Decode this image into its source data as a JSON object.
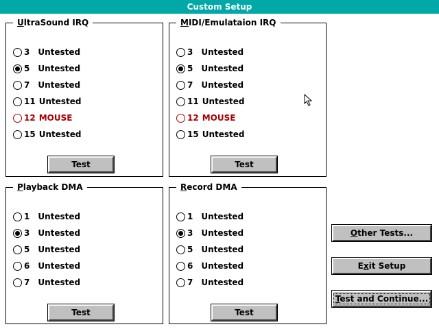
{
  "window": {
    "title": "Custom Setup"
  },
  "ultrasound_irq": {
    "label_u": "U",
    "label_rest": "ltraSound IRQ",
    "options": [
      {
        "num": "3",
        "status": "Untested",
        "selected": false,
        "conflict": false
      },
      {
        "num": "5",
        "status": "Untested",
        "selected": true,
        "conflict": false
      },
      {
        "num": "7",
        "status": "Untested",
        "selected": false,
        "conflict": false
      },
      {
        "num": "11",
        "status": "Untested",
        "selected": false,
        "conflict": false
      },
      {
        "num": "12",
        "status": "MOUSE",
        "selected": false,
        "conflict": true
      },
      {
        "num": "15",
        "status": "Untested",
        "selected": false,
        "conflict": false
      }
    ],
    "test_label": "Test"
  },
  "midi_irq": {
    "label_u": "M",
    "label_rest": "IDI/Emulataion IRQ",
    "options": [
      {
        "num": "3",
        "status": "Untested",
        "selected": false,
        "conflict": false
      },
      {
        "num": "5",
        "status": "Untested",
        "selected": true,
        "conflict": false
      },
      {
        "num": "7",
        "status": "Untested",
        "selected": false,
        "conflict": false
      },
      {
        "num": "11",
        "status": "Untested",
        "selected": false,
        "conflict": false
      },
      {
        "num": "12",
        "status": "MOUSE",
        "selected": false,
        "conflict": true
      },
      {
        "num": "15",
        "status": "Untested",
        "selected": false,
        "conflict": false
      }
    ],
    "test_label": "Test"
  },
  "playback_dma": {
    "label_u": "P",
    "label_rest": "layback DMA",
    "options": [
      {
        "num": "1",
        "status": "Untested",
        "selected": false
      },
      {
        "num": "3",
        "status": "Untested",
        "selected": true
      },
      {
        "num": "5",
        "status": "Untested",
        "selected": false
      },
      {
        "num": "6",
        "status": "Untested",
        "selected": false
      },
      {
        "num": "7",
        "status": "Untested",
        "selected": false
      }
    ],
    "test_label": "Test"
  },
  "record_dma": {
    "label_u": "R",
    "label_rest": "ecord DMA",
    "options": [
      {
        "num": "1",
        "status": "Untested",
        "selected": false
      },
      {
        "num": "3",
        "status": "Untested",
        "selected": true
      },
      {
        "num": "5",
        "status": "Untested",
        "selected": false
      },
      {
        "num": "6",
        "status": "Untested",
        "selected": false
      },
      {
        "num": "7",
        "status": "Untested",
        "selected": false
      }
    ],
    "test_label": "Test"
  },
  "buttons": {
    "other_tests_u": "O",
    "other_tests_rest": "ther Tests...",
    "exit_setup_pre": "E",
    "exit_setup_u": "x",
    "exit_setup_rest": "it Setup",
    "test_continue_u": "T",
    "test_continue_rest": "est and Continue..."
  },
  "colors": {
    "title_bg": "#00a8a8",
    "conflict": "#a80000",
    "button_face": "#c0c0c0"
  },
  "icons": {
    "cursor": "arrow-pointer-icon"
  }
}
